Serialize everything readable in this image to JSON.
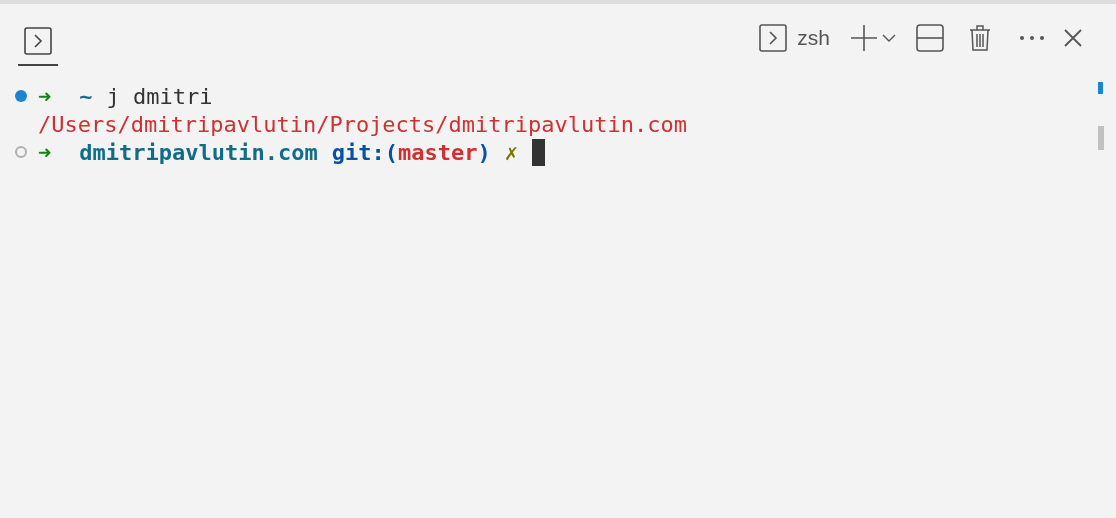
{
  "tabs": [
    {
      "selected": true
    }
  ],
  "toolbar": {
    "terminal_name": "zsh"
  },
  "lines": [
    {
      "marked": true,
      "success": true,
      "segments": [
        {
          "kind": "arrow",
          "text": "➜"
        },
        {
          "kind": "dir",
          "text": "~"
        },
        {
          "kind": "plain",
          "text": "j dmitri"
        }
      ]
    },
    {
      "marked": false,
      "segments": [
        {
          "kind": "error",
          "text": "/Users/dmitripavlutin/Projects/dmitripavlutin.com"
        }
      ]
    },
    {
      "marked": true,
      "success": false,
      "cursor": true,
      "segments": [
        {
          "kind": "arrow",
          "text": "➜"
        },
        {
          "kind": "dir",
          "text": "dmitripavlutin.com"
        },
        {
          "kind": "git",
          "text": "git:("
        },
        {
          "kind": "branch",
          "text": "master"
        },
        {
          "kind": "git",
          "text": ")"
        },
        {
          "kind": "dirty",
          "text": "✗"
        }
      ]
    }
  ]
}
